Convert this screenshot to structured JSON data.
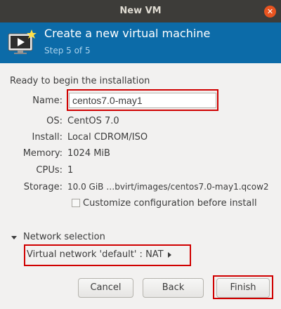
{
  "window": {
    "title": "New VM"
  },
  "banner": {
    "title": "Create a new virtual machine",
    "step": "Step 5 of 5",
    "icon": "monitor-play-icon",
    "color": "#0c6ba8"
  },
  "summary": {
    "heading": "Ready to begin the installation",
    "name_label": "Name:",
    "name_value": "centos7.0-may1",
    "os_label": "OS:",
    "os_value": "CentOS 7.0",
    "install_label": "Install:",
    "install_value": "Local CDROM/ISO",
    "memory_label": "Memory:",
    "memory_value": "1024 MiB",
    "cpus_label": "CPUs:",
    "cpus_value": "1",
    "storage_label": "Storage:",
    "storage_value": "10.0 GiB …bvirt/images/centos7.0-may1.qcow2",
    "customize_label": "Customize configuration before install",
    "customize_checked": false
  },
  "network": {
    "title": "Network selection",
    "selection": "Virtual network 'default' : NAT"
  },
  "buttons": {
    "cancel": "Cancel",
    "back": "Back",
    "finish": "Finish"
  },
  "highlight_color": "#d00000"
}
